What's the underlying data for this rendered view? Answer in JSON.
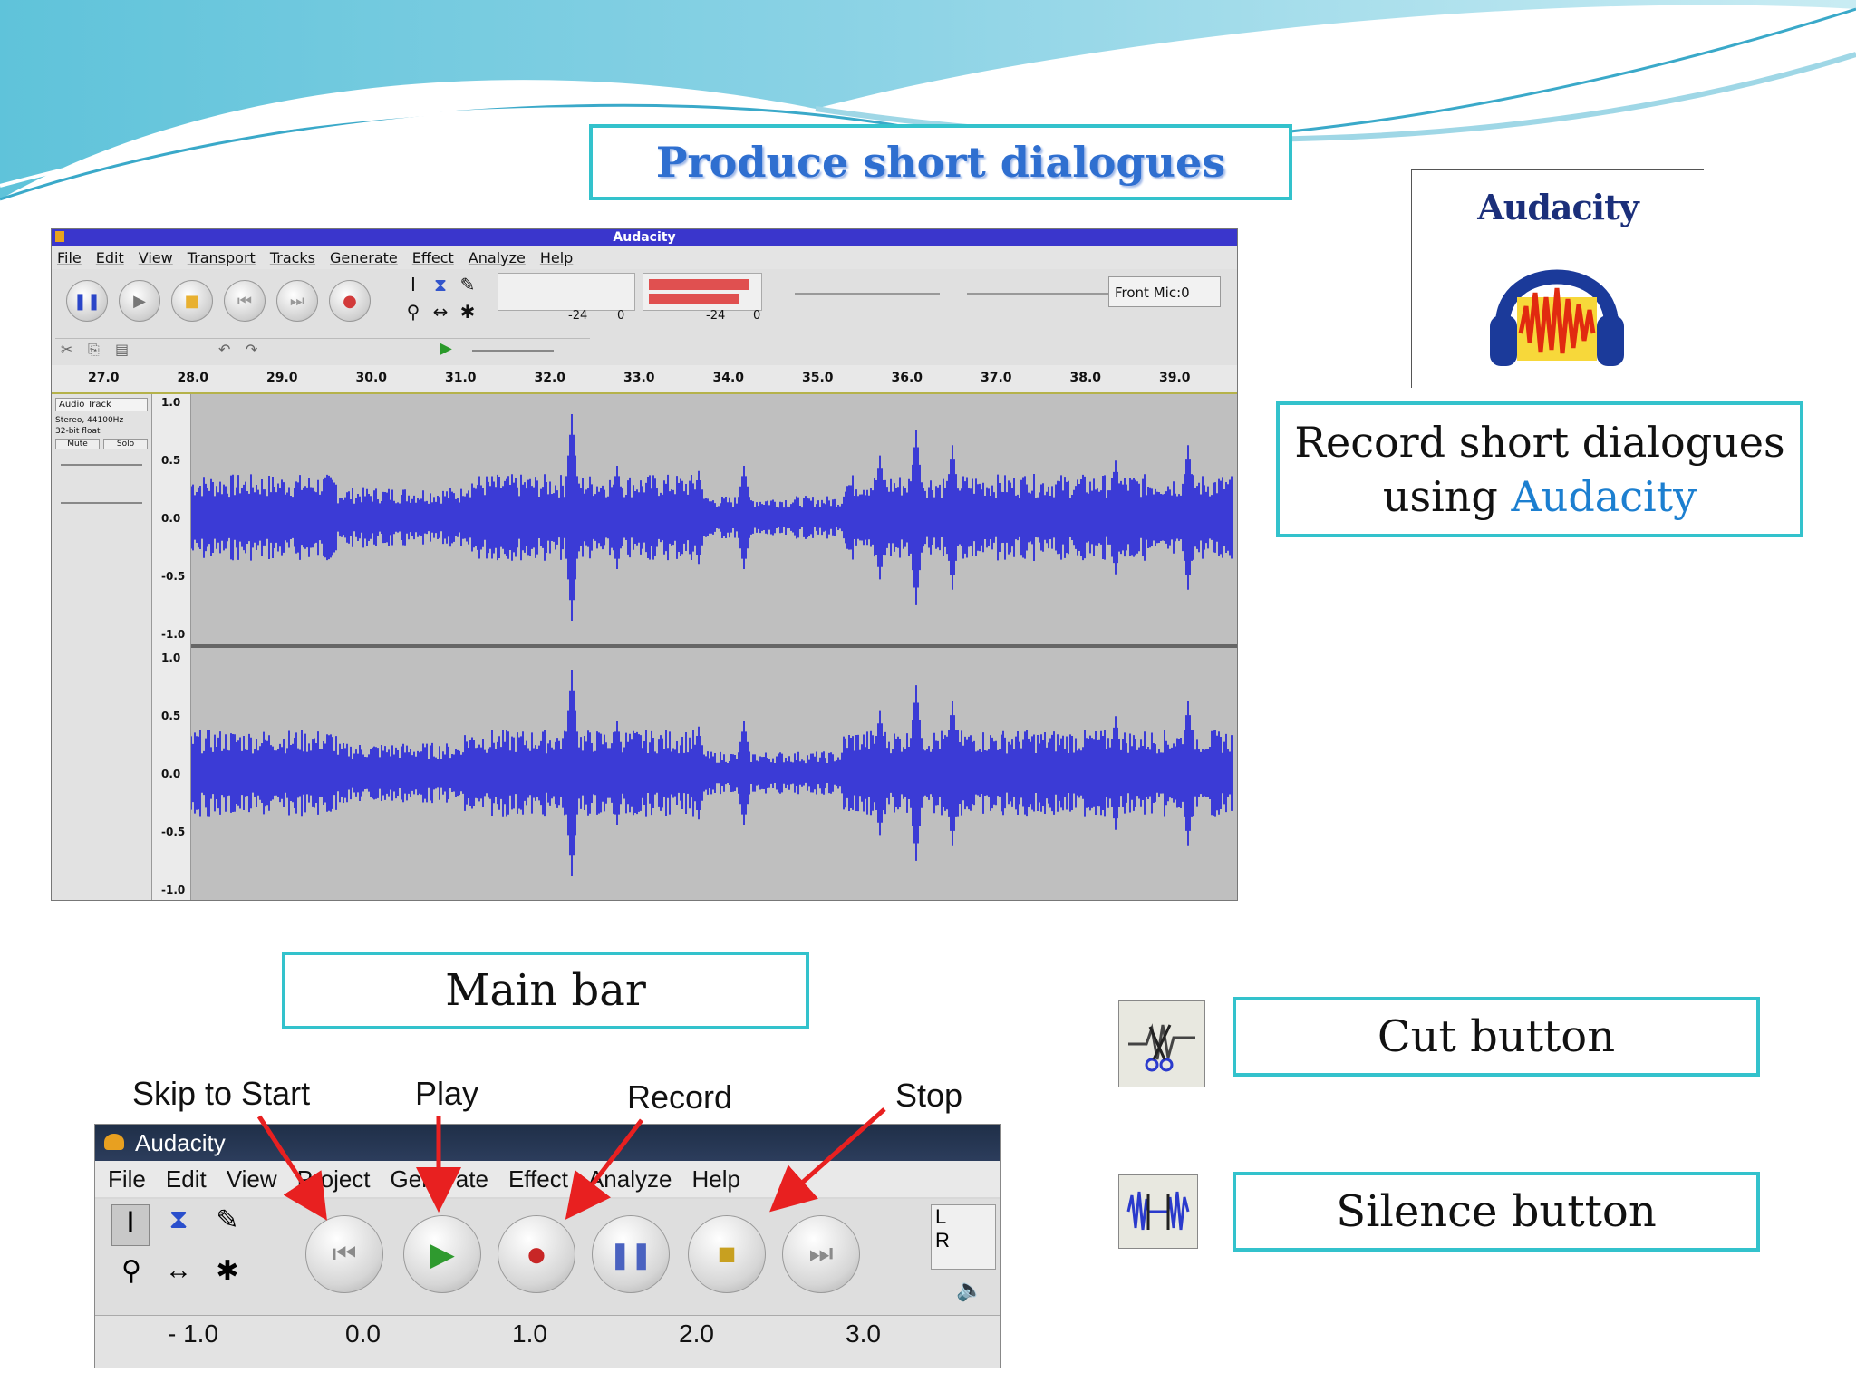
{
  "slide": {
    "title": "Produce short dialogues",
    "record_text_1": "Record short dialogues",
    "record_text_2": "using ",
    "record_text_accent": "Audacity",
    "main_bar_label": "Main bar",
    "cut_label": "Cut button",
    "silence_label": "Silence button",
    "accent_color": "#33c2cc"
  },
  "logo": {
    "text": "Audacity"
  },
  "audacity_window": {
    "title": "Audacity",
    "menu": [
      "File",
      "Edit",
      "View",
      "Transport",
      "Tracks",
      "Generate",
      "Effect",
      "Analyze",
      "Help"
    ],
    "meter_left_marks": [
      "-24",
      "0"
    ],
    "meter_right_marks": [
      "-24",
      "0"
    ],
    "input_source": "Front Mic:0",
    "ruler": [
      "27.0",
      "28.0",
      "29.0",
      "30.0",
      "31.0",
      "32.0",
      "33.0",
      "34.0",
      "35.0",
      "36.0",
      "37.0",
      "38.0",
      "39.0"
    ],
    "track": {
      "name": "Audio Track",
      "format": "Stereo, 44100Hz",
      "bits": "32-bit float",
      "mute": "Mute",
      "solo": "Solo"
    },
    "scale": [
      "1.0",
      "0.5",
      "0.0",
      "-0.5",
      "-1.0"
    ]
  },
  "main_bar": {
    "title": "Audacity",
    "menu": [
      "File",
      "Edit",
      "View",
      "Project",
      "Generate",
      "Effect",
      "Analyze",
      "Help"
    ],
    "ruler": [
      "- 1.0",
      "0.0",
      "1.0",
      "2.0",
      "3.0"
    ],
    "annotations": {
      "skip": "Skip to Start",
      "play": "Play",
      "record": "Record",
      "stop": "Stop"
    }
  }
}
